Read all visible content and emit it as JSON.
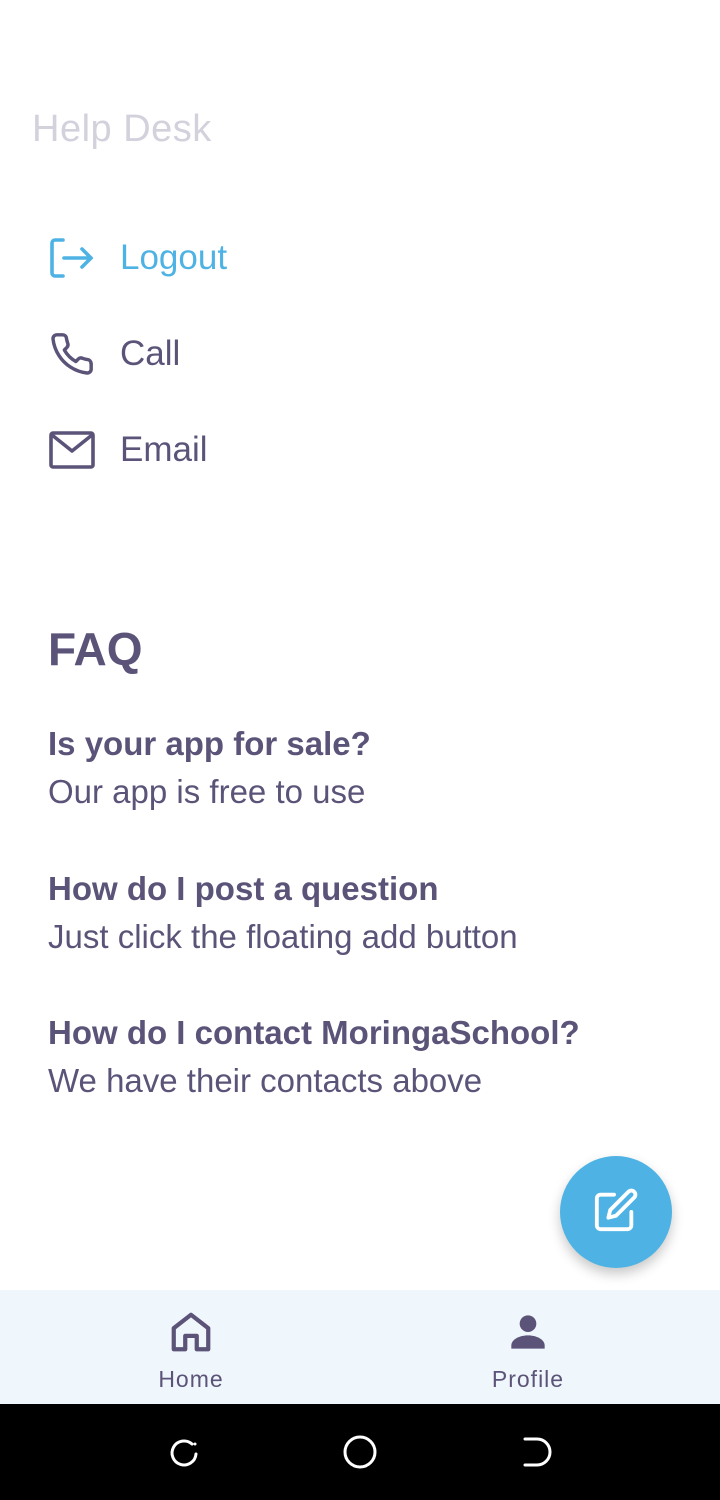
{
  "header": {
    "title": "Help Desk"
  },
  "menu": {
    "logout": {
      "label": "Logout",
      "icon": "logout-icon"
    },
    "call": {
      "label": "Call",
      "icon": "phone-icon"
    },
    "email": {
      "label": "Email",
      "icon": "mail-icon"
    }
  },
  "faq": {
    "title": "FAQ",
    "items": [
      {
        "question": "Is your app for sale?",
        "answer": "Our app is free to use"
      },
      {
        "question": "How do I post a question",
        "answer": "Just click the floating add button"
      },
      {
        "question": "How do I contact MoringaSchool?",
        "answer": "We have their contacts above"
      }
    ]
  },
  "fab": {
    "icon": "edit-icon"
  },
  "bottom_nav": {
    "items": [
      {
        "label": "Home",
        "icon": "home-icon"
      },
      {
        "label": "Profile",
        "icon": "person-icon"
      }
    ]
  },
  "system_nav": {
    "icons": [
      "recent-apps-icon",
      "home-circle-icon",
      "back-icon"
    ]
  },
  "colors": {
    "accent": "#4eb3e4",
    "text": "#5b5378",
    "title_muted": "#d3d1dc",
    "nav_bg": "#eff6fc"
  }
}
